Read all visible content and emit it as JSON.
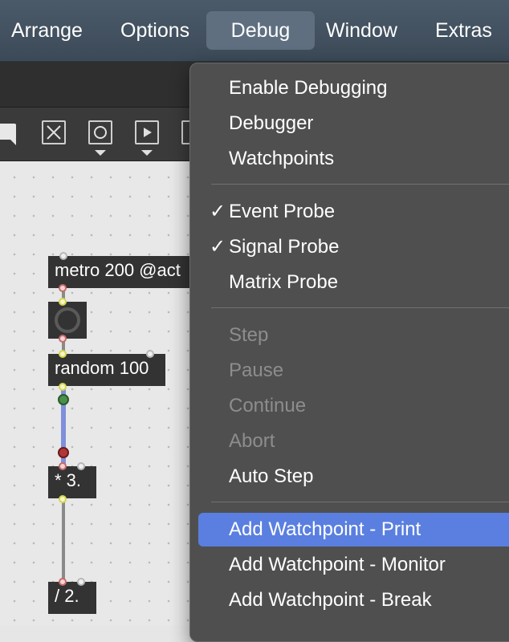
{
  "menubar": {
    "items": [
      {
        "label": "Arrange",
        "active": false
      },
      {
        "label": "Options",
        "active": false
      },
      {
        "label": "Debug",
        "active": true
      },
      {
        "label": "Window",
        "active": false
      },
      {
        "label": "Extras",
        "active": false
      }
    ]
  },
  "toolbar": {
    "icons": [
      "comment-icon",
      "toggle-x-icon",
      "button-circle-icon",
      "play-icon",
      "more-icon"
    ]
  },
  "patcher": {
    "objects": {
      "metro": "metro 200 @act",
      "random": "random 100",
      "multiply": "* 3.",
      "divide": "/ 2."
    },
    "colors": {
      "object_bg": "#333333",
      "probe_cord": "#7f8fd9",
      "probe_green": "#4a8f4a",
      "probe_red": "#b33636"
    }
  },
  "debug_menu": {
    "items": [
      {
        "label": "Enable Debugging",
        "checked": false,
        "enabled": true
      },
      {
        "label": "Debugger",
        "checked": false,
        "enabled": true
      },
      {
        "label": "Watchpoints",
        "checked": false,
        "enabled": true
      },
      {
        "label": "Event Probe",
        "checked": true,
        "enabled": true
      },
      {
        "label": "Signal Probe",
        "checked": true,
        "enabled": true
      },
      {
        "label": "Matrix Probe",
        "checked": false,
        "enabled": true
      },
      {
        "label": "Step",
        "checked": false,
        "enabled": false
      },
      {
        "label": "Pause",
        "checked": false,
        "enabled": false
      },
      {
        "label": "Continue",
        "checked": false,
        "enabled": false
      },
      {
        "label": "Abort",
        "checked": false,
        "enabled": false
      },
      {
        "label": "Auto Step",
        "checked": false,
        "enabled": true
      },
      {
        "label": "Add Watchpoint - Print",
        "checked": false,
        "enabled": true,
        "highlighted": true
      },
      {
        "label": "Add Watchpoint - Monitor",
        "checked": false,
        "enabled": true
      },
      {
        "label": "Add Watchpoint - Break",
        "checked": false,
        "enabled": true
      }
    ],
    "checkmark": "✓",
    "highlight_color": "#5a7fe0"
  }
}
